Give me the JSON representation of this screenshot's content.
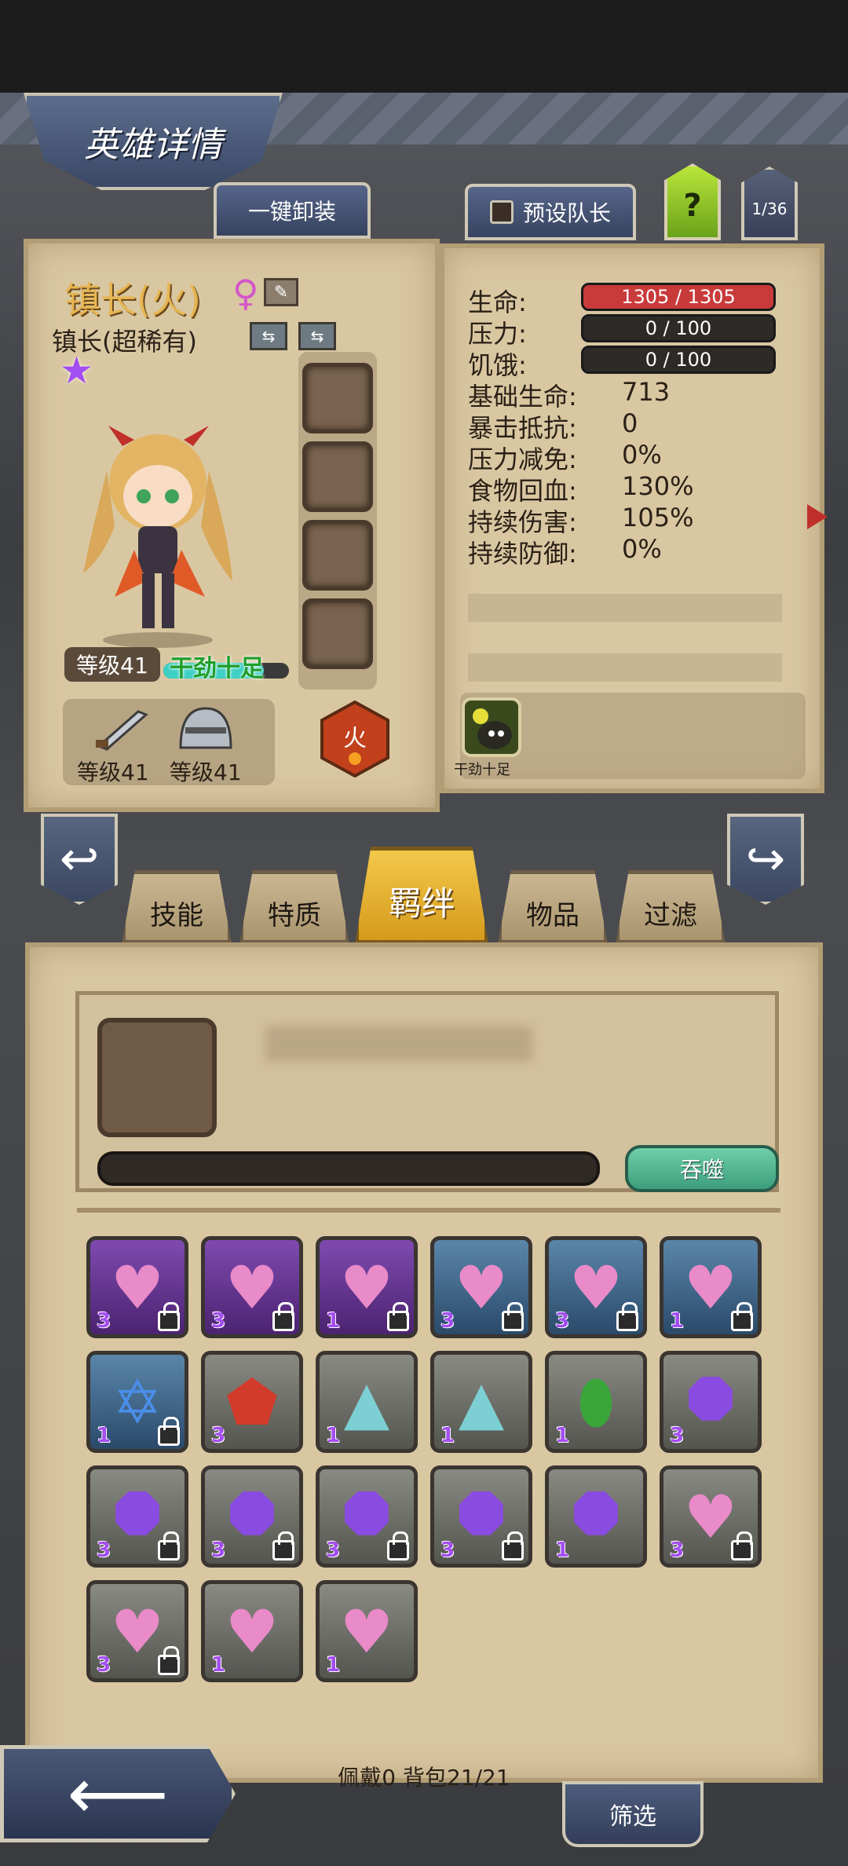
{
  "header": {
    "title": "英雄详情",
    "unload_all": "一键卸装",
    "preset_leader": "预设队长",
    "help": "?",
    "hero_index": "1/36"
  },
  "hero": {
    "name": "镇长(火)",
    "gender_symbol": "♀",
    "class": "镇长(超稀有)",
    "rarity_stars": 1,
    "level": "等级41",
    "mood": "干劲十足",
    "mood_level": 0.8,
    "weapon_level": "等级41",
    "armor_level": "等级41",
    "element": "火",
    "accent_color": "#e6b552"
  },
  "stats": {
    "hp_label": "生命:",
    "hp_value": "1305 / 1305",
    "stress_label": "压力:",
    "stress_value": "0 / 100",
    "hunger_label": "饥饿:",
    "hunger_value": "0 / 100",
    "rows": [
      {
        "label": "基础生命:",
        "value": "713"
      },
      {
        "label": "暴击抵抗:",
        "value": "0"
      },
      {
        "label": "压力减免:",
        "value": "0%"
      },
      {
        "label": "食物回血:",
        "value": "130%"
      },
      {
        "label": "持续伤害:",
        "value": "105%"
      },
      {
        "label": "持续防御:",
        "value": "0%"
      }
    ],
    "trait_label": "干劲十足",
    "hp_color": "#c93a3a",
    "bar_color": "#2d2a27"
  },
  "tabs": [
    {
      "label": "技能"
    },
    {
      "label": "特质"
    },
    {
      "label": "羁绊"
    },
    {
      "label": "物品"
    },
    {
      "label": "过滤"
    }
  ],
  "bond_panel": {
    "devour_label": "吞噬",
    "items": [
      {
        "frame": "purple",
        "gem": "heart",
        "qty": "3",
        "locked": true
      },
      {
        "frame": "purple",
        "gem": "heart",
        "qty": "3",
        "locked": true
      },
      {
        "frame": "purple",
        "gem": "heart",
        "qty": "1",
        "locked": true
      },
      {
        "frame": "blue",
        "gem": "heart",
        "qty": "3",
        "locked": true
      },
      {
        "frame": "blue",
        "gem": "heart",
        "qty": "3",
        "locked": true
      },
      {
        "frame": "blue",
        "gem": "heart",
        "qty": "1",
        "locked": true
      },
      {
        "frame": "blue",
        "gem": "star-of-david",
        "qty": "1",
        "locked": true
      },
      {
        "frame": "gray",
        "gem": "red-pentagon",
        "qty": "3",
        "locked": false
      },
      {
        "frame": "gray",
        "gem": "teal-triangle",
        "qty": "1",
        "locked": false
      },
      {
        "frame": "gray",
        "gem": "teal-triangle",
        "qty": "1",
        "locked": false
      },
      {
        "frame": "gray",
        "gem": "green-drop",
        "qty": "1",
        "locked": false
      },
      {
        "frame": "gray",
        "gem": "purple-octagon",
        "qty": "3",
        "locked": false
      },
      {
        "frame": "gray",
        "gem": "purple-octagon",
        "qty": "3",
        "locked": true
      },
      {
        "frame": "gray",
        "gem": "purple-octagon",
        "qty": "3",
        "locked": true
      },
      {
        "frame": "gray",
        "gem": "purple-octagon",
        "qty": "3",
        "locked": true
      },
      {
        "frame": "gray",
        "gem": "purple-octagon",
        "qty": "3",
        "locked": true
      },
      {
        "frame": "gray",
        "gem": "purple-octagon",
        "qty": "1",
        "locked": false
      },
      {
        "frame": "gray",
        "gem": "heart",
        "qty": "3",
        "locked": true
      },
      {
        "frame": "gray",
        "gem": "heart",
        "qty": "3",
        "locked": true
      },
      {
        "frame": "gray",
        "gem": "heart",
        "qty": "1",
        "locked": false
      },
      {
        "frame": "gray",
        "gem": "heart",
        "qty": "1",
        "locked": false
      }
    ]
  },
  "footer": {
    "status": "佩戴0 背包21/21",
    "filter_label": "筛选"
  }
}
